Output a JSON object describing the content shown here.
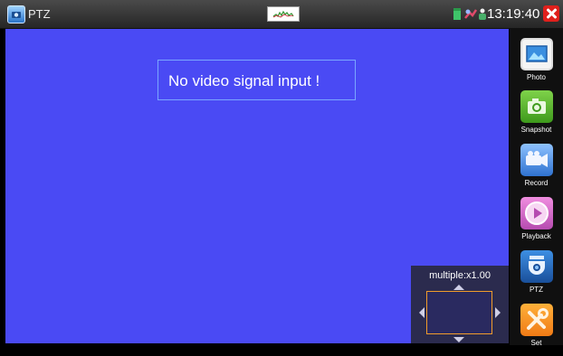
{
  "titlebar": {
    "app_icon": "camera-app-icon",
    "title": "PTZ",
    "signal_widget_icon": "signal-waveform-icon",
    "status_icons": [
      "sd-card-icon",
      "network-cable-icon",
      "ptz-person-icon"
    ],
    "time": "13:19:40",
    "close_icon": "close-icon"
  },
  "video": {
    "message": "No video signal input  !",
    "background_color": "#4a4af4"
  },
  "ptz_control": {
    "multiple_label": "multiple:x1.00"
  },
  "sidebar": {
    "items": [
      {
        "label": "Photo",
        "icon": "photo-icon",
        "color": "#f4f4f4"
      },
      {
        "label": "Snapshot",
        "icon": "camera-icon",
        "color": "#4fb224"
      },
      {
        "label": "Record",
        "icon": "video-camera-icon",
        "color": "#2f72cf"
      },
      {
        "label": "Playback",
        "icon": "play-icon",
        "color": "#c65ac0"
      },
      {
        "label": "PTZ",
        "icon": "ptz-dome-camera-icon",
        "color": "#2a6fc4"
      },
      {
        "label": "Set",
        "icon": "tools-icon",
        "color": "#f38a1d"
      }
    ]
  }
}
